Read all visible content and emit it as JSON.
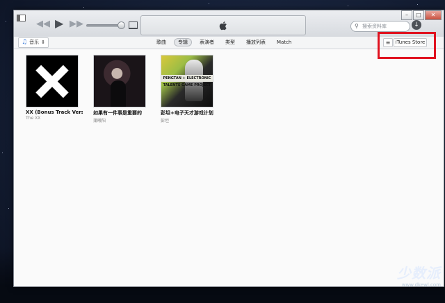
{
  "window": {
    "minimize_glyph": "–",
    "maximize_glyph": "□",
    "close_glyph": "✕"
  },
  "player": {
    "rewind_glyph": "◀◀",
    "play_glyph": "▶",
    "forward_glyph": "▶▶",
    "volume_level": 0.9
  },
  "search": {
    "placeholder": "搜索资料库",
    "icon": "search-icon"
  },
  "library_select": {
    "label": "音乐",
    "icon": "music-note-icon",
    "arrows": "⇕"
  },
  "tabs": [
    {
      "label": "歌曲",
      "active": false
    },
    {
      "label": "专辑",
      "active": true
    },
    {
      "label": "表演者",
      "active": false
    },
    {
      "label": "类型",
      "active": false
    },
    {
      "label": "播放列表",
      "active": false
    },
    {
      "label": "Match",
      "active": false
    }
  ],
  "toolbar": {
    "list_glyph": "≡",
    "store_label": "iTunes Store"
  },
  "albums": [
    {
      "title": "XX (Bonus Track Versi...",
      "artist": "The XX"
    },
    {
      "title": "如果有一件事是重要的",
      "artist": "蒲曦阳"
    },
    {
      "title": "彭坦+电子天才游戏计划",
      "artist": "彭坦"
    }
  ],
  "cover3_text": "PENGTAN + ELECTRONIC TALENTS GAME PROJECT",
  "watermark": {
    "big": "少数派",
    "small": "www.dkewl.com"
  },
  "colors": {
    "highlight": "#e0121f",
    "accent": "#2d72d6"
  }
}
